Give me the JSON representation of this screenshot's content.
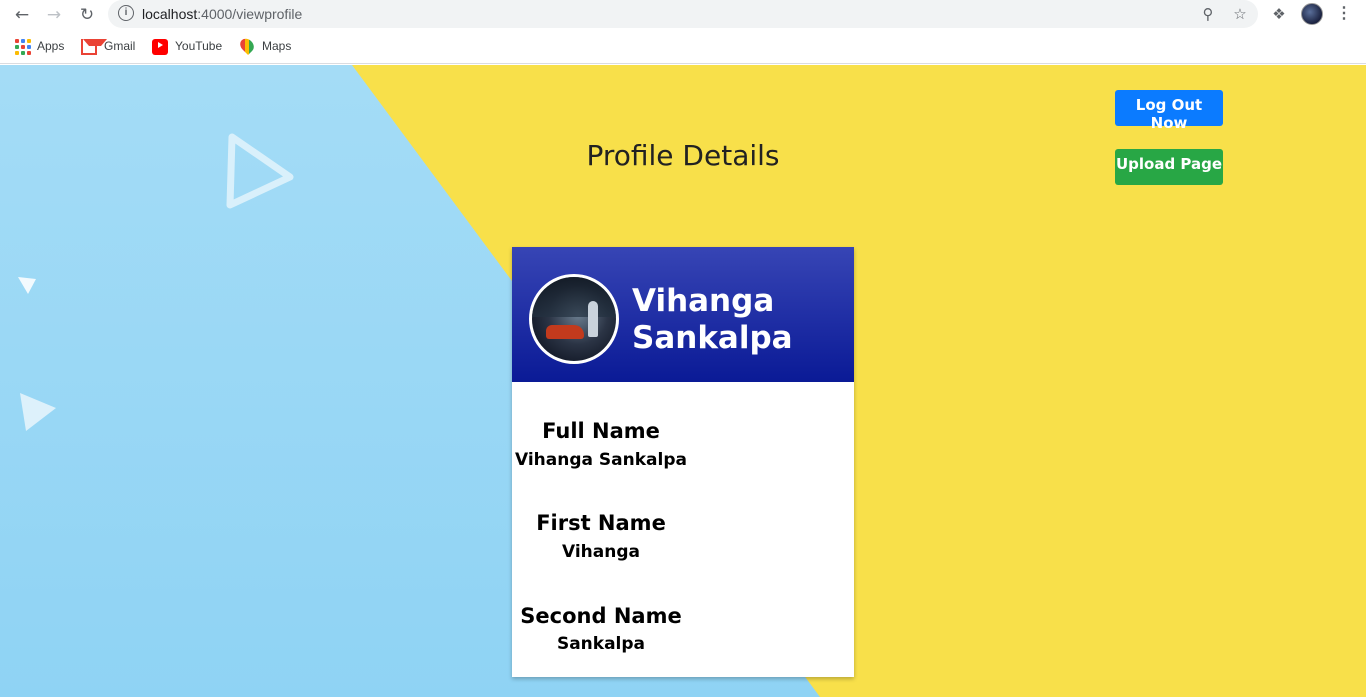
{
  "browser": {
    "url_host": "localhost",
    "url_path": ":4000/viewprofile",
    "bookmarks": [
      {
        "label": "Apps",
        "icon": "apps-grid-icon"
      },
      {
        "label": "Gmail",
        "icon": "gmail-icon"
      },
      {
        "label": "YouTube",
        "icon": "youtube-icon"
      },
      {
        "label": "Maps",
        "icon": "maps-icon"
      }
    ]
  },
  "page": {
    "title": "Profile Details",
    "logout_label": "Log Out Now",
    "upload_label": "Upload Page",
    "colors": {
      "background_yellow": "#f8e04a",
      "background_blue": "#9cd8f5",
      "logout_button": "#0b7bff",
      "upload_button": "#28a745",
      "card_header": "#1a2aa5"
    }
  },
  "profile": {
    "name_line1": "Vihanga",
    "name_line2": "Sankalpa",
    "fields": [
      {
        "label": "Full Name",
        "value": "Vihanga Sankalpa"
      },
      {
        "label": "First Name",
        "value": "Vihanga"
      },
      {
        "label": "Second Name",
        "value": "Sankalpa"
      }
    ]
  }
}
